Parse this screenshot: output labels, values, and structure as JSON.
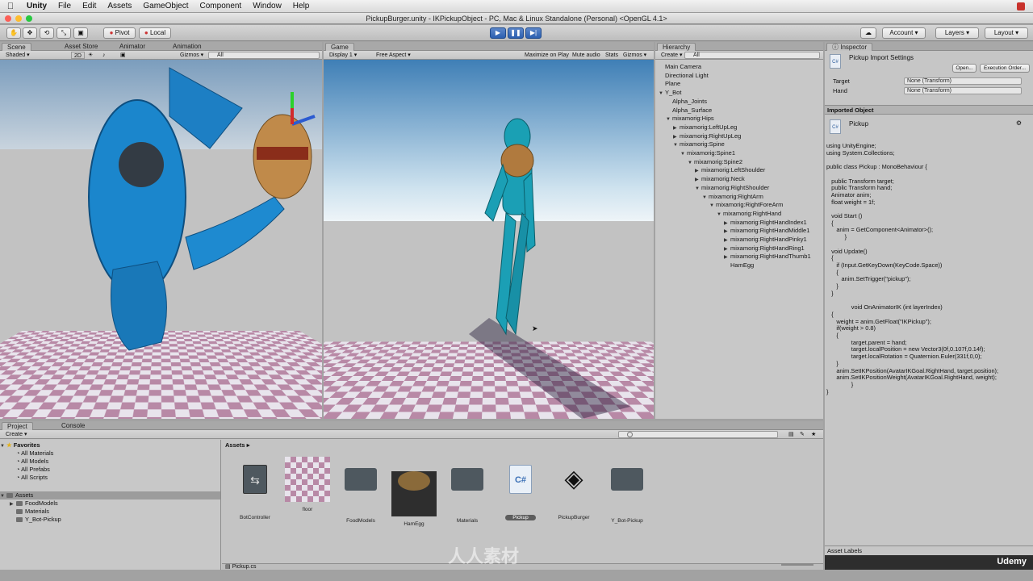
{
  "menubar": {
    "app": "Unity",
    "items": [
      "File",
      "Edit",
      "Assets",
      "GameObject",
      "Component",
      "Window",
      "Help"
    ]
  },
  "window": {
    "title": "PickupBurger.unity - IKPickupObject - PC, Mac & Linux Standalone (Personal) <OpenGL 4.1>"
  },
  "toolbar": {
    "pivot": "Pivot",
    "local": "Local",
    "account": "Account",
    "layers": "Layers",
    "layout": "Layout"
  },
  "scene": {
    "tabs": [
      "Scene",
      "Asset Store",
      "Animator",
      "Animation"
    ],
    "shading": "Shaded",
    "mode_2d": "2D",
    "gizmos": "Gizmos",
    "search": "All"
  },
  "game": {
    "tab": "Game",
    "display": "Display 1",
    "aspect": "Free Aspect",
    "maximize": "Maximize on Play",
    "mute": "Mute audio",
    "stats": "Stats",
    "gizmos": "Gizmos"
  },
  "hierarchy": {
    "tab": "Hierarchy",
    "create": "Create",
    "search": "All",
    "rows": [
      {
        "label": "Main Camera",
        "indent": 0,
        "arrow": ""
      },
      {
        "label": "Directional Light",
        "indent": 0,
        "arrow": ""
      },
      {
        "label": "Plane",
        "indent": 0,
        "arrow": ""
      },
      {
        "label": "Y_Bot",
        "indent": 0,
        "arrow": "▼"
      },
      {
        "label": "Alpha_Joints",
        "indent": 1,
        "arrow": ""
      },
      {
        "label": "Alpha_Surface",
        "indent": 1,
        "arrow": ""
      },
      {
        "label": "mixamorig:Hips",
        "indent": 1,
        "arrow": "▼"
      },
      {
        "label": "mixamorig:LeftUpLeg",
        "indent": 2,
        "arrow": "▶"
      },
      {
        "label": "mixamorig:RightUpLeg",
        "indent": 2,
        "arrow": "▶"
      },
      {
        "label": "mixamorig:Spine",
        "indent": 2,
        "arrow": "▼"
      },
      {
        "label": "mixamorig:Spine1",
        "indent": 3,
        "arrow": "▼"
      },
      {
        "label": "mixamorig:Spine2",
        "indent": 4,
        "arrow": "▼"
      },
      {
        "label": "mixamorig:LeftShoulder",
        "indent": 5,
        "arrow": "▶"
      },
      {
        "label": "mixamorig:Neck",
        "indent": 5,
        "arrow": "▶"
      },
      {
        "label": "mixamorig:RightShoulder",
        "indent": 5,
        "arrow": "▼"
      },
      {
        "label": "mixamorig:RightArm",
        "indent": 6,
        "arrow": "▼"
      },
      {
        "label": "mixamorig:RightForeArm",
        "indent": 7,
        "arrow": "▼"
      },
      {
        "label": "mixamorig:RightHand",
        "indent": 8,
        "arrow": "▼"
      },
      {
        "label": "mixamorig:RightHandIndex1",
        "indent": 9,
        "arrow": "▶"
      },
      {
        "label": "mixamorig:RightHandMiddle1",
        "indent": 9,
        "arrow": "▶"
      },
      {
        "label": "mixamorig:RightHandPinky1",
        "indent": 9,
        "arrow": "▶"
      },
      {
        "label": "mixamorig:RightHandRing1",
        "indent": 9,
        "arrow": "▶"
      },
      {
        "label": "mixamorig:RightHandThumb1",
        "indent": 9,
        "arrow": "▶"
      },
      {
        "label": "HamEgg",
        "indent": 9,
        "arrow": ""
      }
    ]
  },
  "inspector": {
    "tab": "Inspector",
    "header": "Pickup Import Settings",
    "open": "Open...",
    "exec_order": "Execution Order...",
    "fields": [
      {
        "label": "Target",
        "value": "None (Transform)"
      },
      {
        "label": "Hand",
        "value": "None (Transform)"
      }
    ],
    "imported_object": "Imported Object",
    "object_name": "Pickup",
    "code": "using UnityEngine;\nusing System.Collections;\n\npublic class Pickup : MonoBehaviour {\n\n   public Transform target;\n   public Transform hand;\n   Animator anim;\n   float weight = 1f;\n\n   void Start ()\n   {\n      anim = GetComponent<Animator>();\n           }\n\n   void Update()\n   {\n      if (Input.GetKeyDown(KeyCode.Space))\n      {\n         anim.SetTrigger(\"pickup\");\n      }\n   }\n\n               void OnAnimatorIK (int layerIndex)\n   {\n      weight = anim.GetFloat(\"IKPickup\");\n      if(weight > 0.8)\n      {\n               target.parent = hand;\n               target.localPosition = new Vector3(0f,0.107f,0.14f);\n               target.localRotation = Quaternion.Euler(331f,0,0);\n      }\n      anim.SetIKPosition(AvatarIKGoal.RightHand, target.position);\n      anim.SetIKPositionWeight(AvatarIKGoal.RightHand, weight);\n               }\n}",
    "asset_labels": "Asset Labels"
  },
  "project": {
    "tabs": [
      "Project",
      "Console"
    ],
    "create": "Create",
    "favorites_label": "Favorites",
    "favorites": [
      "All Materials",
      "All Models",
      "All Prefabs",
      "All Scripts"
    ],
    "assets_label": "Assets",
    "folders": [
      "FoodModels",
      "Materials",
      "Y_Bot-Pickup"
    ],
    "breadcrumb": "Assets",
    "assets": [
      {
        "name": "BotController",
        "kind": "controller"
      },
      {
        "name": "floor",
        "kind": "material"
      },
      {
        "name": "FoodModels",
        "kind": "folder"
      },
      {
        "name": "HamEgg",
        "kind": "model"
      },
      {
        "name": "Materials",
        "kind": "folder"
      },
      {
        "name": "Pickup",
        "kind": "script"
      },
      {
        "name": "PickupBurger",
        "kind": "scene"
      },
      {
        "name": "Y_Bot-Pickup",
        "kind": "folder"
      }
    ],
    "selected_asset": "Pickup",
    "status_file": "Pickup.cs"
  },
  "overlays": {
    "udemy": "Udemy",
    "watermark": "人人素材"
  },
  "colors": {
    "accent_blue": "#2c5fb0",
    "robot_blue": "#1d7fc4",
    "floor_pink": "#b889a6"
  }
}
